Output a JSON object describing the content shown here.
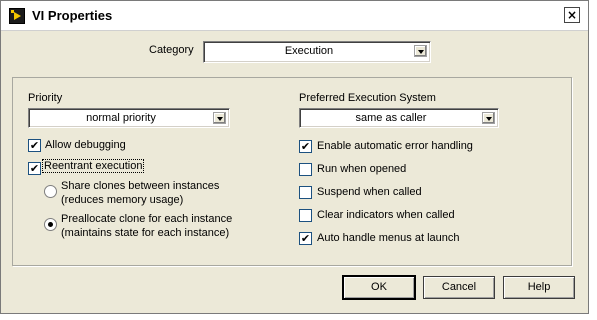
{
  "window": {
    "title": "VI Properties",
    "close_glyph": "×",
    "app_icon": "labview-icon"
  },
  "category": {
    "label": "Category",
    "value": "Execution"
  },
  "left": {
    "priority_label": "Priority",
    "priority_value": "normal priority",
    "allow_debugging": {
      "label": "Allow debugging",
      "checked": true
    },
    "reentrant": {
      "label": "Reentrant execution",
      "checked": true
    },
    "share_clones": {
      "line1": "Share clones between instances",
      "line2": "(reduces memory usage)",
      "selected": false
    },
    "preallocate": {
      "line1": "Preallocate clone for each instance",
      "line2": "(maintains state for each instance)",
      "selected": true
    }
  },
  "right": {
    "exec_system_label": "Preferred Execution System",
    "exec_system_value": "same as caller",
    "options": [
      {
        "label": "Enable automatic error handling",
        "checked": true
      },
      {
        "label": "Run when opened",
        "checked": false
      },
      {
        "label": "Suspend when called",
        "checked": false
      },
      {
        "label": "Clear indicators when called",
        "checked": false
      },
      {
        "label": "Auto handle menus at launch",
        "checked": true
      }
    ]
  },
  "buttons": {
    "ok": "OK",
    "cancel": "Cancel",
    "help": "Help"
  },
  "check_glyph": "✔"
}
